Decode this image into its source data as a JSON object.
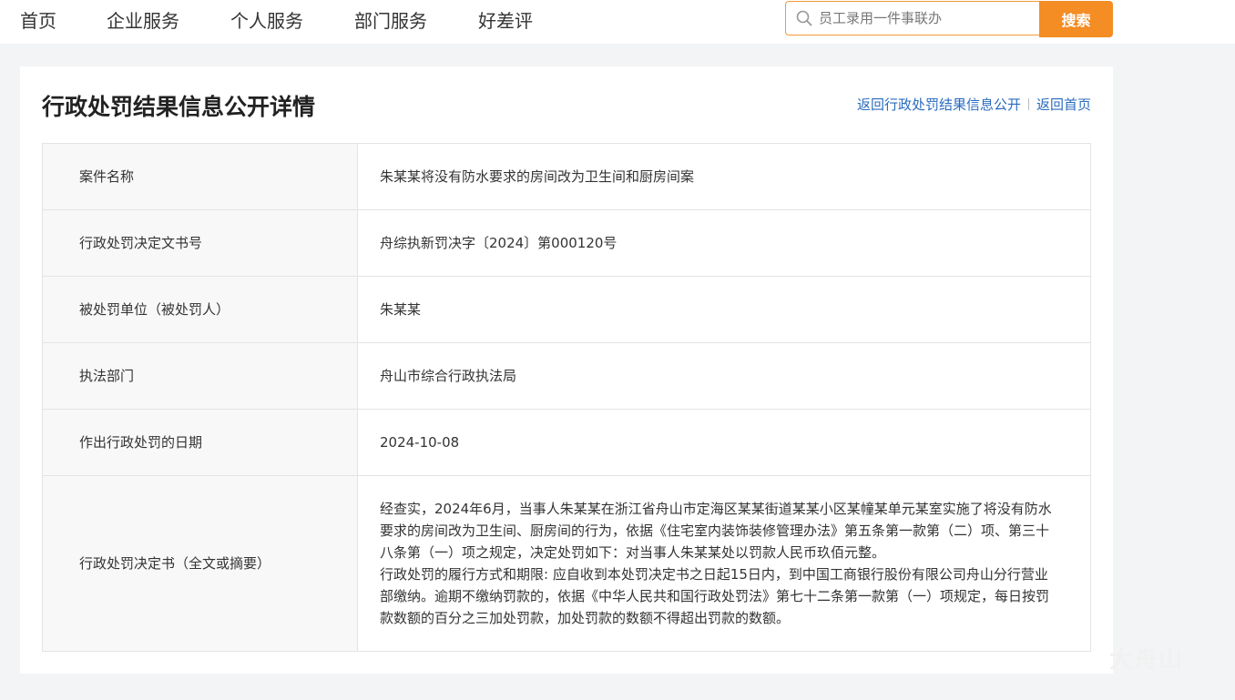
{
  "nav": {
    "items": [
      {
        "label": "首页"
      },
      {
        "label": "企业服务"
      },
      {
        "label": "个人服务"
      },
      {
        "label": "部门服务"
      },
      {
        "label": "好差评"
      }
    ]
  },
  "search": {
    "placeholder": "员工录用一件事联办",
    "button_label": "搜索"
  },
  "page": {
    "title": "行政处罚结果信息公开详情",
    "link_back_list": "返回行政处罚结果信息公开",
    "link_home": "返回首页"
  },
  "details": {
    "rows": [
      {
        "label": "案件名称",
        "value": "朱某某将没有防水要求的房间改为卫生间和厨房间案"
      },
      {
        "label": "行政处罚决定文书号",
        "value": "舟综执新罚决字〔2024〕第000120号"
      },
      {
        "label": "被处罚单位（被处罚人）",
        "value": "朱某某"
      },
      {
        "label": "执法部门",
        "value": "舟山市综合行政执法局"
      },
      {
        "label": "作出行政处罚的日期",
        "value": "2024-10-08"
      }
    ],
    "decision": {
      "label": "行政处罚决定书（全文或摘要）",
      "paragraph1": "经查实，2024年6月，当事人朱某某在浙江省舟山市定海区某某街道某某小区某幢某单元某室实施了将没有防水要求的房间改为卫生间、厨房间的行为，依据《住宅室内装饰装修管理办法》第五条第一款第（二）项、第三十八条第（一）项之规定，决定处罚如下：对当事人朱某某处以罚款人民币玖佰元整。",
      "paragraph2": "行政处罚的履行方式和期限: 应自收到本处罚决定书之日起15日内，到中国工商银行股份有限公司舟山分行营业部缴纳。逾期不缴纳罚款的，依据《中华人民共和国行政处罚法》第七十二条第一款第（一）项规定，每日按罚款数额的百分之三加处罚款，加处罚款的数额不得超出罚款的数额。"
    }
  },
  "watermark": "大舟山",
  "colors": {
    "accent": "#f48d24",
    "link": "#2a6bbf"
  }
}
